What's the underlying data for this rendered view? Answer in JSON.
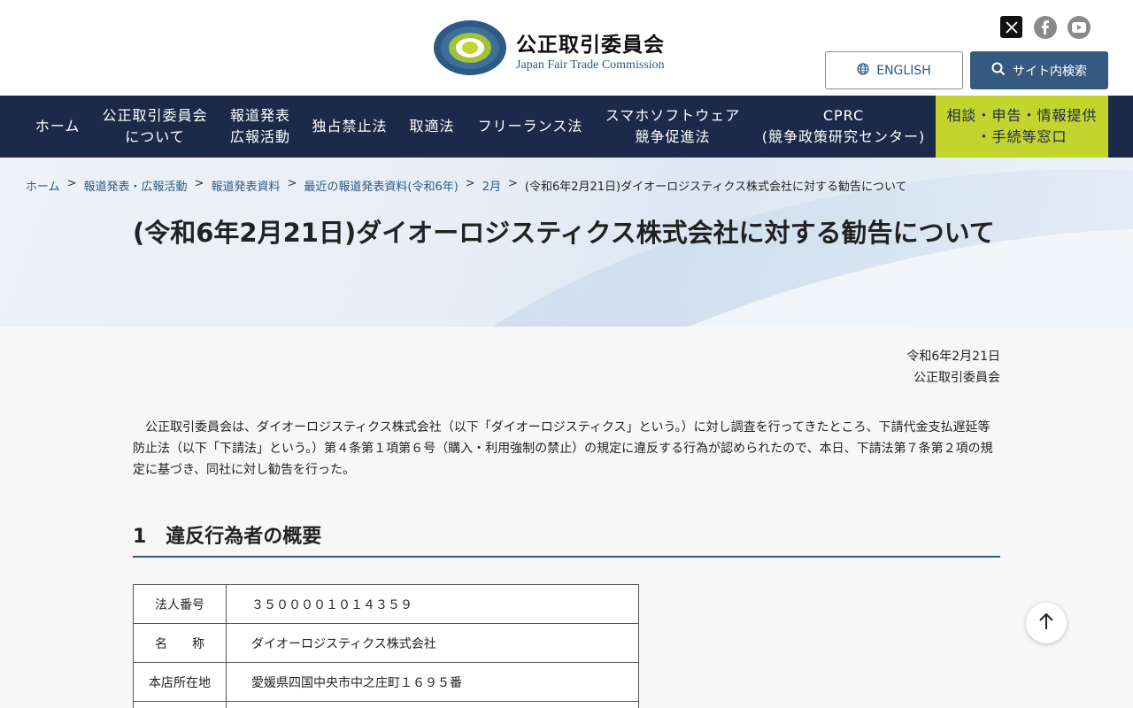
{
  "header": {
    "logo_jp": "公正取引委員会",
    "logo_en": "Japan Fair Trade Commission",
    "english_label": "ENGLISH",
    "search_label": "サイト内検索",
    "social": [
      "x-icon",
      "facebook-icon",
      "youtube-icon"
    ]
  },
  "nav": {
    "items": [
      {
        "label": "ホーム"
      },
      {
        "label": "公正取引委員会\nについて"
      },
      {
        "label": "報道発表\n広報活動"
      },
      {
        "label": "独占禁止法"
      },
      {
        "label": "取適法"
      },
      {
        "label": "フリーランス法"
      },
      {
        "label": "スマホソフトウェア\n競争促進法"
      },
      {
        "label": "CPRC\n(競争政策研究センター)"
      }
    ],
    "consult_label": "相談・申告・情報提供\n・手続等窓口"
  },
  "breadcrumb": {
    "items": [
      {
        "label": "ホーム"
      },
      {
        "label": "報道発表・広報活動"
      },
      {
        "label": "報道発表資料"
      },
      {
        "label": "最近の報道発表資料(令和6年)"
      },
      {
        "label": "2月"
      }
    ],
    "separator": ">",
    "current": "(令和6年2月21日)ダイオーロジスティクス株式会社に対する勧告について"
  },
  "page": {
    "title": "(令和6年2月21日)ダイオーロジスティクス株式会社に対する勧告について",
    "date": "令和6年2月21日",
    "issuer": "公正取引委員会",
    "lead": "公正取引委員会は、ダイオーロジスティクス株式会社（以下「ダイオーロジスティクス」という。）に対し調査を行ってきたところ、下請代金支払遅延等防止法（以下「下請法」という。）第４条第１項第６号（購入・利用強制の禁止）の規定に違反する行為が認められたので、本日、下請法第７条第２項の規定に基づき、同社に対し勧告を行った。",
    "section_heading": "1　違反行為者の概要",
    "table": [
      {
        "label": "法人番号",
        "value": "３５００００１０１４３５９"
      },
      {
        "label": "名　　称",
        "value": "ダイオーロジスティクス株式会社"
      },
      {
        "label": "本店所在地",
        "value": "愛媛県四国中央市中之庄町１６９５番"
      },
      {
        "label": "",
        "value": ""
      }
    ]
  },
  "colors": {
    "nav_bg": "#1c2a4a",
    "accent": "#2b5a86",
    "consult_bg": "#c4d42e"
  }
}
